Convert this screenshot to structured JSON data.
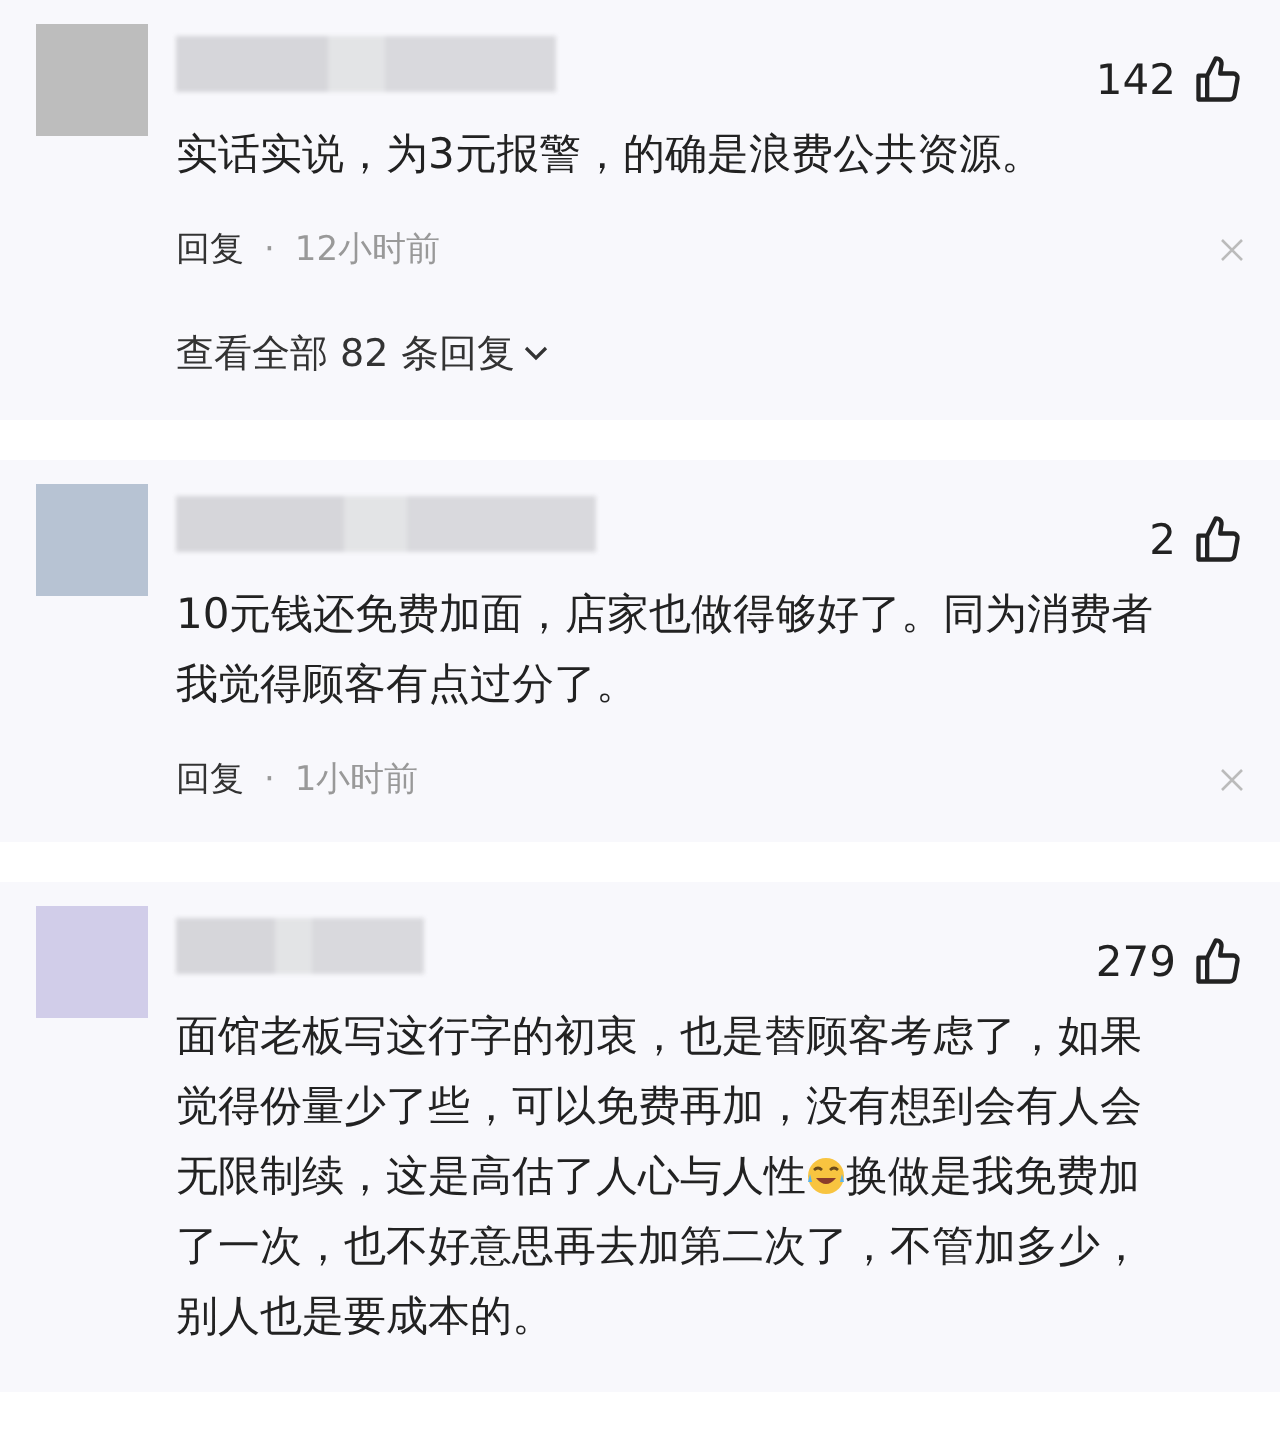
{
  "comments": [
    {
      "likes": "142",
      "body": [
        {
          "kind": "text",
          "text": "实话实说，为3元报警，的确是浪费公共资源。"
        }
      ],
      "reply": "回复",
      "separator": "·",
      "time": "12小时前",
      "view_all": "查看全部 82 条回复"
    },
    {
      "likes": "2",
      "body": [
        {
          "kind": "text",
          "text": "10元钱还免费加面，店家也做得够好了。同为消费者我觉得顾客有点过分了。"
        }
      ],
      "reply": "回复",
      "separator": "·",
      "time": "1小时前"
    },
    {
      "likes": "279",
      "body": [
        {
          "kind": "text",
          "text": "面馆老板写这行字的初衷，也是替顾客考虑了，如果觉得份量少了些，可以免费再加，没有想到会有人会无限制续，这是高估了人心与人性"
        },
        {
          "kind": "emoji"
        },
        {
          "kind": "text",
          "text": "换做是我免费加了一次，也不好意思再去加第二次了，不管加多少，别人也是要成本的。"
        }
      ]
    }
  ]
}
